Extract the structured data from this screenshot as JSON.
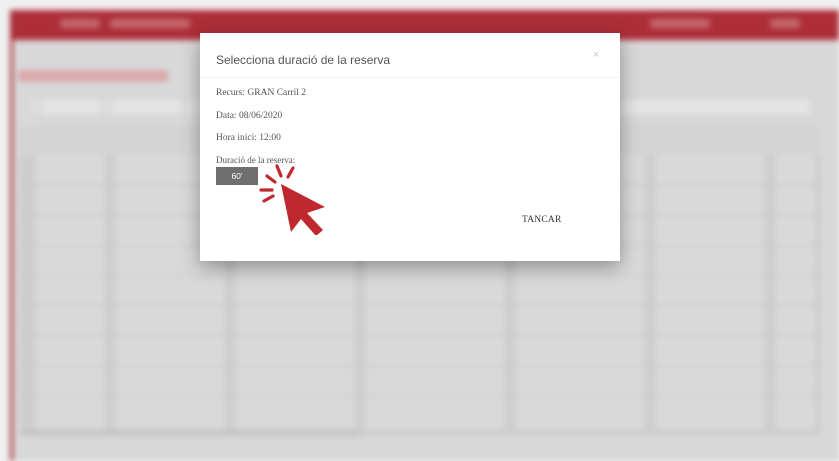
{
  "dialog": {
    "title": "Selecciona duració de la reserva",
    "close_glyph": "×",
    "resource_line": "Recurs: GRAN Carril 2",
    "date_line": "Data: 08/06/2020",
    "start_time_line": "Hora inici: 12:00",
    "duration_label": "Duració de la reserva:",
    "duration_value": "60'",
    "close_button_label": "TANCAR"
  },
  "icons": {
    "pointer": "click-pointer-icon",
    "close": "close-icon"
  },
  "colors": {
    "brand": "#b8313c",
    "pointer": "#c0282f",
    "select_bg": "#6e6e6e"
  }
}
